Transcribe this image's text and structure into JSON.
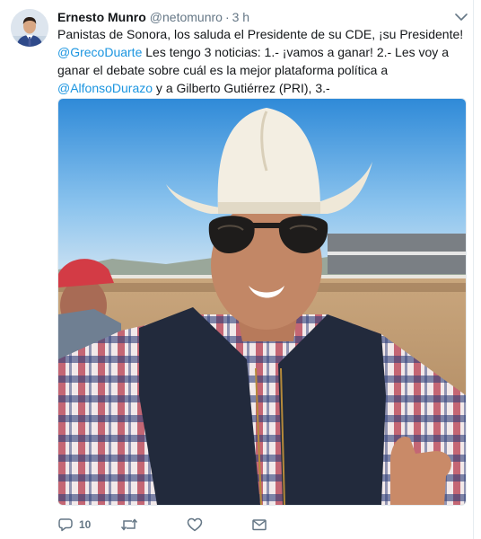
{
  "tweet": {
    "author_name": "Ernesto Munro",
    "author_handle": "@netomunro",
    "separator": "·",
    "timestamp": "3 h",
    "text": {
      "part1": "Panistas de Sonora, los saluda el Presidente de su CDE, ¡su Presidente!",
      "mention1": "@GrecoDuarte",
      "part2": " Les tengo 3 noticias: 1.- ¡vamos a ganar! 2.- Les voy a ganar el debate sobre cuál es la mejor plataforma política a ",
      "mention2": "@AlfonsoDurazo",
      "part3": " y a Gilberto Gutiérrez (PRI), 3.-"
    },
    "media_description": "photo",
    "actions": {
      "reply_count": "10",
      "retweet_count": "",
      "like_count": ""
    }
  },
  "icons": {
    "menu": "chevron-down-icon",
    "reply": "reply-icon",
    "retweet": "retweet-icon",
    "like": "heart-icon",
    "dm": "envelope-icon"
  },
  "colors": {
    "link": "#1b95e0",
    "text": "#14171a",
    "muted": "#657786",
    "border": "#e6ecf0"
  }
}
